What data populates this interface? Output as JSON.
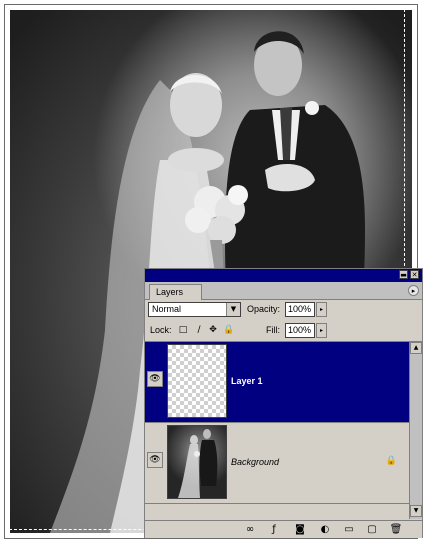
{
  "palette": {
    "tab_label": "Layers",
    "titlebar_buttons": {
      "minimize": "▬",
      "close": "✕"
    },
    "menu_arrow": "▸",
    "blend_mode": "Normal",
    "select_arrow": "▼",
    "opacity_label": "Opacity:",
    "opacity_value": "100%",
    "fill_label": "Fill:",
    "fill_value": "100%",
    "slider_arrow": "▸",
    "lock_label": "Lock:",
    "lock_icons": [
      "□",
      "∕",
      "✥",
      "🔒"
    ],
    "layers": [
      {
        "name": "Layer 1",
        "selected": true,
        "thumbnail": "transparent-checkerboard",
        "visible_icon": "eye-icon"
      },
      {
        "name": "Background",
        "selected": false,
        "thumbnail": "photo",
        "locked": true,
        "visible_icon": "eye-icon"
      }
    ],
    "eye_glyph": "👁",
    "lock_glyph": "🔒",
    "scroll_up": "▲",
    "scroll_down": "▼",
    "bottom_buttons": [
      "∞",
      "ƒ",
      "◙",
      "◐",
      "▭",
      "▢",
      "🗑"
    ]
  },
  "colors": {
    "titlebar": "#000080",
    "selected_row": "#000080",
    "panel_bg": "#d4d0c8"
  }
}
